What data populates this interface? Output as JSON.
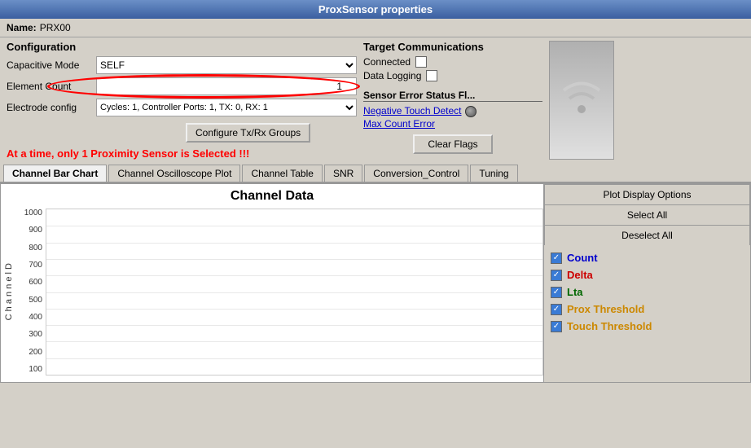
{
  "titleBar": {
    "title": "ProxSensor properties"
  },
  "nameRow": {
    "label": "Name:",
    "value": "PRX00"
  },
  "config": {
    "title": "Configuration",
    "capacitiveModeLabel": "Capacitive Mode",
    "capacitiveModeValue": "SELF",
    "elementCountLabel": "Element Count",
    "elementCountValue": "1",
    "electrodeConfigLabel": "Electrode config",
    "electrodeConfigValue": "Cycles:  1, Controller Ports:  1, TX:  0, RX:  1",
    "configureBtnLabel": "Configure Tx/Rx Groups",
    "warningText": "At a time, only 1 Proximity Sensor is Selected !!!"
  },
  "targetComms": {
    "title": "Target Communications",
    "connected": "Connected",
    "dataLogging": "Data Logging"
  },
  "sensorError": {
    "title": "Sensor Error Status Fl...",
    "negativeTouchDetect": "Negative Touch Detect",
    "maxCountError": "Max Count Error",
    "clearFlagsLabel": "Clear Flags"
  },
  "tabs": [
    {
      "label": "Channel Bar Chart",
      "active": true
    },
    {
      "label": "Channel Oscilloscope Plot",
      "active": false
    },
    {
      "label": "Channel Table",
      "active": false
    },
    {
      "label": "SNR",
      "active": false
    },
    {
      "label": "Conversion_Control",
      "active": false
    },
    {
      "label": "Tuning",
      "active": false
    }
  ],
  "chart": {
    "title": "Channel Data",
    "yAxisLabel": "C h a n n e l D",
    "yLabels": [
      "1000",
      "900",
      "800",
      "700",
      "600",
      "500",
      "400",
      "300",
      "200",
      "100"
    ],
    "plotDisplayOptionsLabel": "Plot Display Options",
    "selectAllLabel": "Select All",
    "deselectAllLabel": "Deselect All",
    "legend": [
      {
        "label": "Count",
        "color": "#0000cc",
        "checked": true
      },
      {
        "label": "Delta",
        "color": "#cc0000",
        "checked": true
      },
      {
        "label": "Lta",
        "color": "#006600",
        "checked": true
      },
      {
        "label": "Prox Threshold",
        "color": "#cc8800",
        "checked": true
      },
      {
        "label": "Touch Threshold",
        "color": "#cc8800",
        "checked": true
      }
    ]
  }
}
